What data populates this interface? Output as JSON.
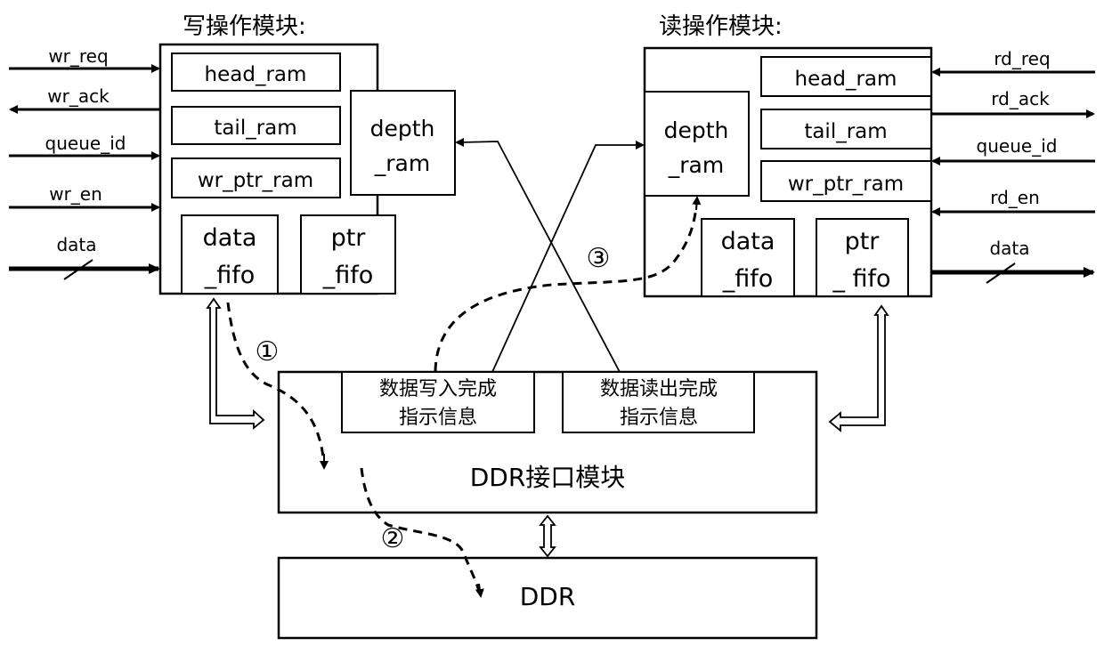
{
  "write_module": {
    "title": "写操作模块:",
    "signals": [
      {
        "label": "wr_req",
        "direction": "in"
      },
      {
        "label": "wr_ack",
        "direction": "out"
      },
      {
        "label": "queue_id",
        "direction": "in"
      },
      {
        "label": "wr_en",
        "direction": "in"
      },
      {
        "label": "data",
        "direction": "in",
        "bus": true
      }
    ],
    "blocks": {
      "head_ram": "head_ram",
      "tail_ram": "tail_ram",
      "wr_ptr_ram": "wr_ptr_ram",
      "depth_ram_1": "depth",
      "depth_ram_2": "_ram",
      "data_fifo_1": "data",
      "data_fifo_2": "_fifo",
      "ptr_fifo_1": "ptr",
      "ptr_fifo_2": "_fifo"
    }
  },
  "read_module": {
    "title": "读操作模块:",
    "signals": [
      {
        "label": "rd_req",
        "direction": "in"
      },
      {
        "label": "rd_ack",
        "direction": "out"
      },
      {
        "label": "queue_id",
        "direction": "in"
      },
      {
        "label": "rd_en",
        "direction": "in"
      },
      {
        "label": "data",
        "direction": "out",
        "bus": true
      }
    ],
    "blocks": {
      "head_ram": "head_ram",
      "tail_ram": "tail_ram",
      "wr_ptr_ram": "wr_ptr_ram",
      "depth_ram_1": "depth",
      "depth_ram_2": "_ram",
      "data_fifo_1": "data",
      "data_fifo_2": "_fifo",
      "ptr_fifo_1": "ptr",
      "ptr_fifo_2": "_ fifo"
    }
  },
  "ddr_interface": {
    "title": "DDR接口模块",
    "write_done_1": "数据写入完成",
    "write_done_2": "指示信息",
    "read_done_1": "数据读出完成",
    "read_done_2": "指示信息"
  },
  "ddr": {
    "title": "DDR"
  },
  "steps": [
    "①",
    "②",
    "③"
  ]
}
